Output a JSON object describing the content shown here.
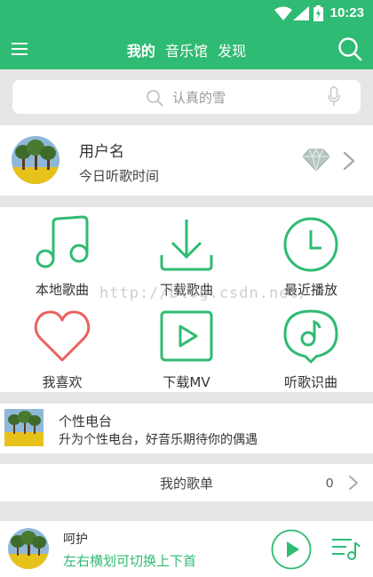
{
  "status_bar": {
    "time": "10:23"
  },
  "header": {
    "tabs": [
      {
        "label": "我的",
        "active": true
      },
      {
        "label": "音乐馆",
        "active": false
      },
      {
        "label": "发现",
        "active": false
      }
    ]
  },
  "search": {
    "placeholder": "认真的雪"
  },
  "profile": {
    "username": "用户名",
    "subtitle": "今日听歌时间"
  },
  "grid": [
    {
      "label": "本地歌曲",
      "icon": "music-note-icon"
    },
    {
      "label": "下载歌曲",
      "icon": "download-icon"
    },
    {
      "label": "最近播放",
      "icon": "clock-icon"
    },
    {
      "label": "我喜欢",
      "icon": "heart-icon"
    },
    {
      "label": "下载MV",
      "icon": "mv-play-icon"
    },
    {
      "label": "听歌识曲",
      "icon": "song-recognition-icon"
    }
  ],
  "watermark": "http://blog.csdn.net/",
  "radio": {
    "title": "个性电台",
    "description": "升为个性电台，好音乐期待你的偶遇"
  },
  "playlist": {
    "label": "我的歌单",
    "count": "0"
  },
  "player": {
    "song": "呵护",
    "hint": "左右横划可切换上下首"
  },
  "colors": {
    "accent": "#2fbb73",
    "heart": "#e9625f",
    "background": "#e6e6e6"
  }
}
